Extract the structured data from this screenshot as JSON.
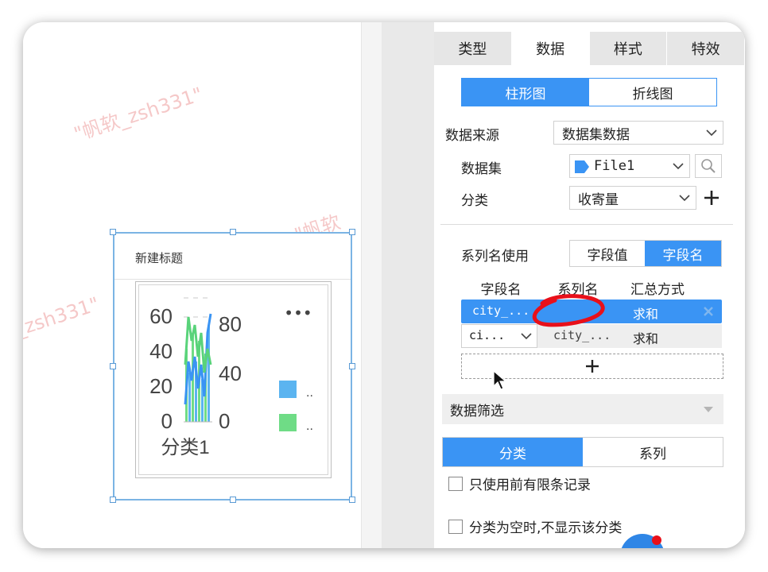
{
  "watermark": "\"帆软_zsh331\"",
  "watermark_short": "\"帆软",
  "widget": {
    "title": "新建标题"
  },
  "chart_data": {
    "type": "bar",
    "categories": [
      "分类1"
    ],
    "left_axis_ticks": [
      "0",
      "20",
      "40",
      "60"
    ],
    "right_axis_ticks": [
      "0",
      "40",
      "80"
    ],
    "more_label": "•••",
    "legend_labels": [
      "..",
      ".."
    ],
    "colors": {
      "series1": "#5bb4f0",
      "series2": "#6fdc86",
      "line1": "#3a94f4",
      "line2": "#59d37a"
    }
  },
  "panel": {
    "tabs": [
      "类型",
      "数据",
      "样式",
      "特效"
    ],
    "chart_type_toggle": {
      "on": "柱形图",
      "off": "折线图"
    },
    "data_source": {
      "label": "数据来源",
      "value": "数据集数据"
    },
    "dataset": {
      "label": "数据集",
      "value": "File1"
    },
    "category": {
      "label": "分类",
      "value": "收寄量"
    },
    "series_name_use": {
      "label": "系列名使用",
      "opt1": "字段值",
      "opt2": "字段名"
    },
    "table": {
      "headers": [
        "字段名",
        "系列名",
        "汇总方式"
      ],
      "rows": [
        {
          "field": "city_...",
          "series": "",
          "agg": "求和"
        },
        {
          "field": "ci...",
          "series": "city_...",
          "agg": "求和"
        }
      ]
    },
    "filter": {
      "label": "数据筛选"
    },
    "filter_toggle": {
      "on": "分类",
      "off": "系列"
    },
    "checkbox1": "只使用前有限条记录",
    "checkbox2": "分类为空时,不显示该分类"
  },
  "colors": {
    "accent": "#3a94f4",
    "annotation": "#e8101a"
  }
}
